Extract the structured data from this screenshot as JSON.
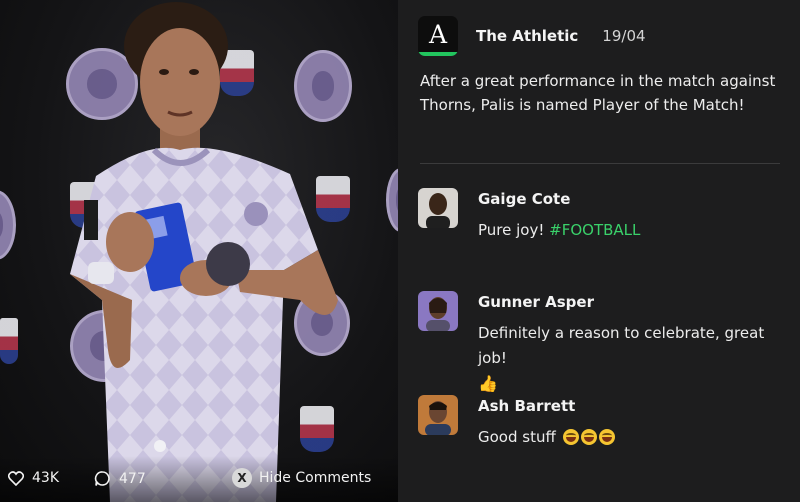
{
  "post": {
    "author": "The Athletic",
    "logo_glyph": "A",
    "date": "19/04",
    "text": "After a great performance in the match against Thorns, Palis is named Player of the Match!"
  },
  "stats": {
    "likes": "43K",
    "comments": "477",
    "hide_comments_label": "Hide Comments",
    "hide_button_glyph": "X"
  },
  "comments": [
    {
      "name": "Gaige Cote",
      "text": "Pure joy! ",
      "hashtag": "#FOOTBALL"
    },
    {
      "name": "Gunner Asper",
      "text": "Definitely a reason to celebrate, great job!",
      "emoji": "👍"
    },
    {
      "name": "Ash Barrett",
      "text": "Good stuff",
      "emoji": "😁😁😁"
    }
  ],
  "colors": {
    "accent_green": "#22c55e",
    "hashtag_green": "#3ad16a",
    "panel_bg": "#1d1d1e"
  },
  "icons": [
    "heart-icon",
    "comment-bubble-icon",
    "x-button-icon"
  ]
}
